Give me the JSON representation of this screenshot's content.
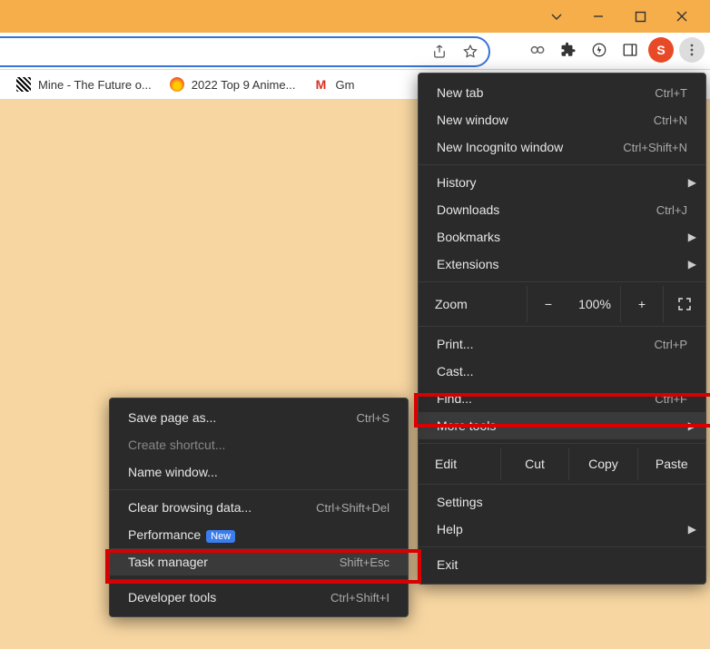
{
  "profile_letter": "S",
  "bookmarks": [
    {
      "label": "Mine - The Future o..."
    },
    {
      "label": "2022 Top 9 Anime..."
    },
    {
      "label": "Gm"
    }
  ],
  "main_menu": {
    "new_tab": {
      "label": "New tab",
      "shortcut": "Ctrl+T"
    },
    "new_window": {
      "label": "New window",
      "shortcut": "Ctrl+N"
    },
    "new_incognito": {
      "label": "New Incognito window",
      "shortcut": "Ctrl+Shift+N"
    },
    "history": {
      "label": "History"
    },
    "downloads": {
      "label": "Downloads",
      "shortcut": "Ctrl+J"
    },
    "bookmarks": {
      "label": "Bookmarks"
    },
    "extensions": {
      "label": "Extensions"
    },
    "zoom": {
      "label": "Zoom",
      "value": "100%"
    },
    "print": {
      "label": "Print...",
      "shortcut": "Ctrl+P"
    },
    "cast": {
      "label": "Cast..."
    },
    "find": {
      "label": "Find...",
      "shortcut": "Ctrl+F"
    },
    "more_tools": {
      "label": "More tools"
    },
    "edit": {
      "label": "Edit",
      "cut": "Cut",
      "copy": "Copy",
      "paste": "Paste"
    },
    "settings": {
      "label": "Settings"
    },
    "help": {
      "label": "Help"
    },
    "exit": {
      "label": "Exit"
    }
  },
  "sub_menu": {
    "save_page": {
      "label": "Save page as...",
      "shortcut": "Ctrl+S"
    },
    "create_shortcut": {
      "label": "Create shortcut..."
    },
    "name_window": {
      "label": "Name window..."
    },
    "clear_data": {
      "label": "Clear browsing data...",
      "shortcut": "Ctrl+Shift+Del"
    },
    "performance": {
      "label": "Performance",
      "tag": "New"
    },
    "task_manager": {
      "label": "Task manager",
      "shortcut": "Shift+Esc"
    },
    "dev_tools": {
      "label": "Developer tools",
      "shortcut": "Ctrl+Shift+I"
    }
  }
}
